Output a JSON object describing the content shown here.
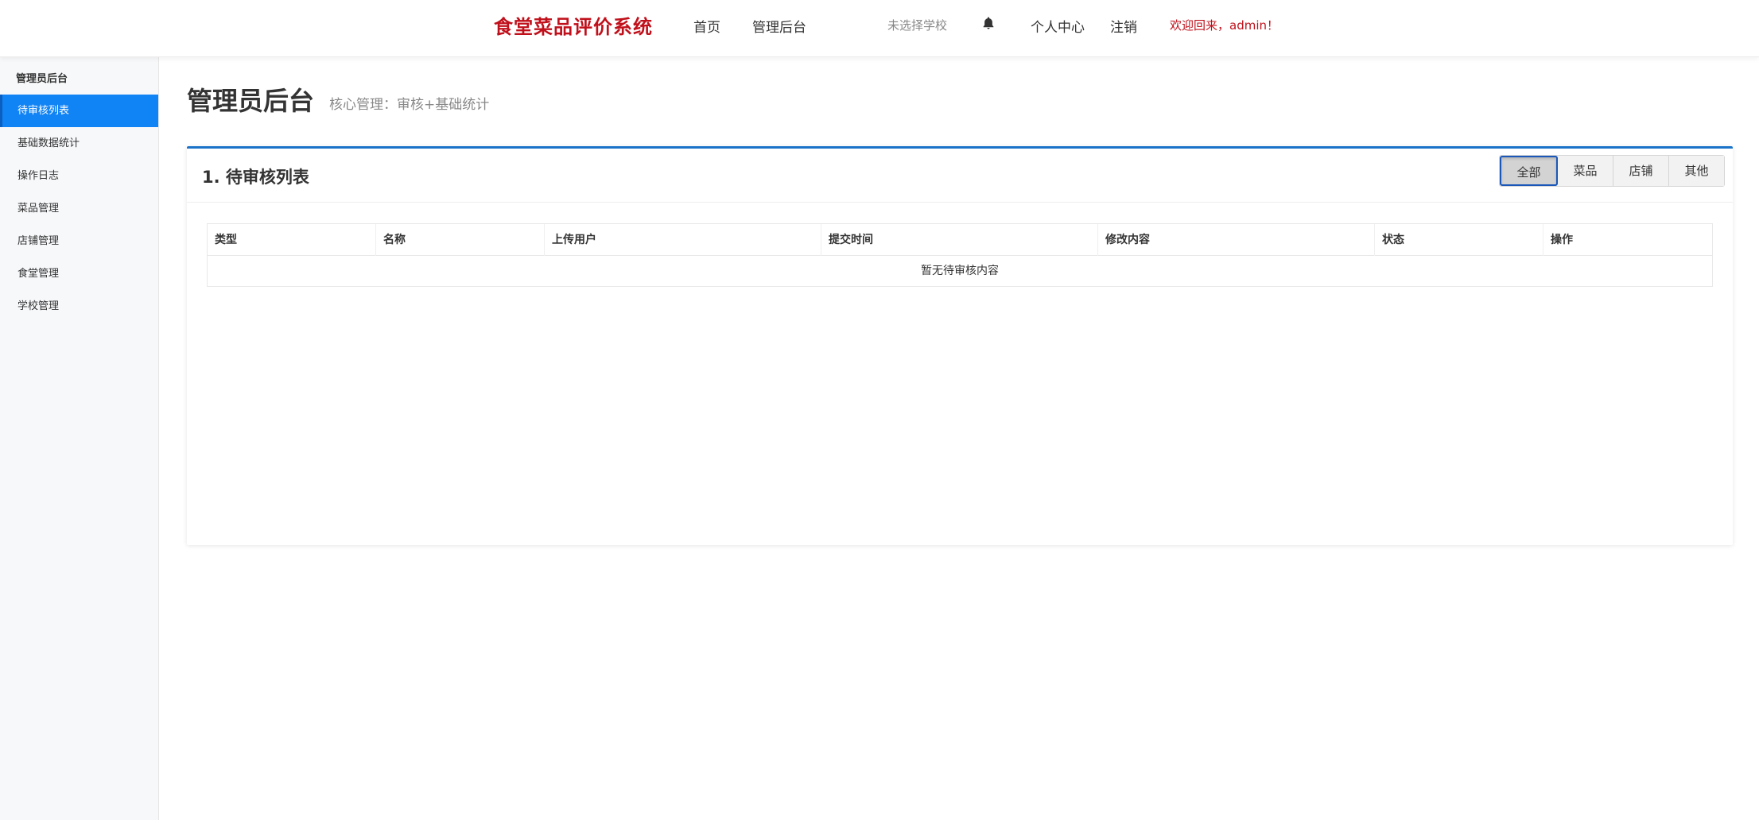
{
  "navbar": {
    "brand": "食堂菜品评价系统",
    "home": "首页",
    "admin": "管理后台",
    "school": "未选择学校",
    "bell_icon": "bell-icon",
    "profile": "个人中心",
    "logout": "注销",
    "welcome": "欢迎回来，admin！",
    "brand_color": "#c0101b"
  },
  "sidebar": {
    "heading": "管理员后台",
    "items": [
      {
        "label": "待审核列表",
        "active": true
      },
      {
        "label": "基础数据统计"
      },
      {
        "label": "操作日志"
      },
      {
        "label": "菜品管理"
      },
      {
        "label": "店铺管理"
      },
      {
        "label": "食堂管理"
      },
      {
        "label": "学校管理"
      }
    ],
    "active_color": "#1083f5"
  },
  "main": {
    "title": "管理员后台",
    "subtitle": "核心管理：审核+基础统计"
  },
  "card": {
    "title": "1. 待审核列表",
    "filters": [
      {
        "label": "全部",
        "active": true
      },
      {
        "label": "菜品"
      },
      {
        "label": "店铺"
      },
      {
        "label": "其他"
      }
    ],
    "table": {
      "columns": [
        "类型",
        "名称",
        "上传用户",
        "提交时间",
        "修改内容",
        "状态",
        "操作"
      ],
      "empty_text": "暂无待审核内容"
    }
  }
}
